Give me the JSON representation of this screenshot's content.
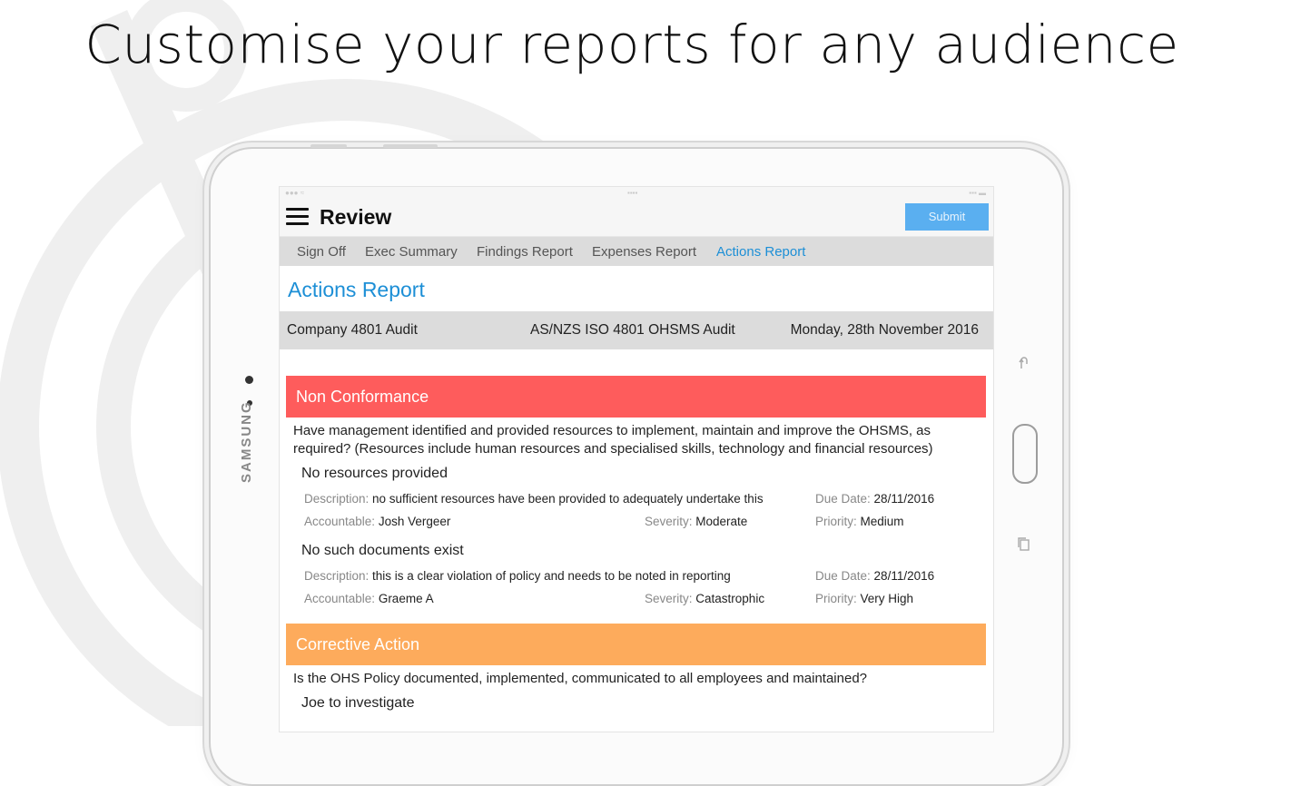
{
  "headline": "Customise your reports for any audience",
  "device": {
    "brand": "SAMSUNG"
  },
  "app": {
    "title": "Review",
    "submit_label": "Submit",
    "tabs": [
      {
        "label": "Sign Off"
      },
      {
        "label": "Exec Summary"
      },
      {
        "label": "Findings Report"
      },
      {
        "label": "Expenses Report"
      },
      {
        "label": "Actions Report",
        "active": true
      }
    ]
  },
  "report": {
    "title": "Actions Report",
    "company": "Company 4801 Audit",
    "audit_name": "AS/NZS ISO 4801 OHSMS Audit",
    "date": "Monday, 28th November 2016"
  },
  "labels": {
    "description": "Description: ",
    "accountable": "Accountable: ",
    "severity": "Severity: ",
    "due_date": "Due Date: ",
    "priority": "Priority: "
  },
  "sections": [
    {
      "heading": "Non Conformance",
      "color": "#fe5c5c",
      "question": "Have management identified and provided resources to implement, maintain and improve the OHSMS, as required? (Resources include human resources and specialised skills, technology and financial resources)",
      "findings": [
        {
          "title": "No resources provided",
          "description": "no sufficient resources have been provided to adequately undertake this",
          "due_date": "28/11/2016",
          "accountable": "Josh Vergeer",
          "severity": "Moderate",
          "priority": "Medium"
        },
        {
          "title": "No such documents exist",
          "description": "this is a clear violation of policy and needs to be noted in reporting",
          "due_date": "28/11/2016",
          "accountable": "Graeme A",
          "severity": "Catastrophic",
          "priority": "Very High"
        }
      ]
    },
    {
      "heading": "Corrective Action",
      "color": "#fdab5c",
      "question": "Is the OHS Policy documented, implemented, communicated to all employees and maintained?",
      "findings": [
        {
          "title": "Joe to investigate"
        }
      ]
    }
  ]
}
